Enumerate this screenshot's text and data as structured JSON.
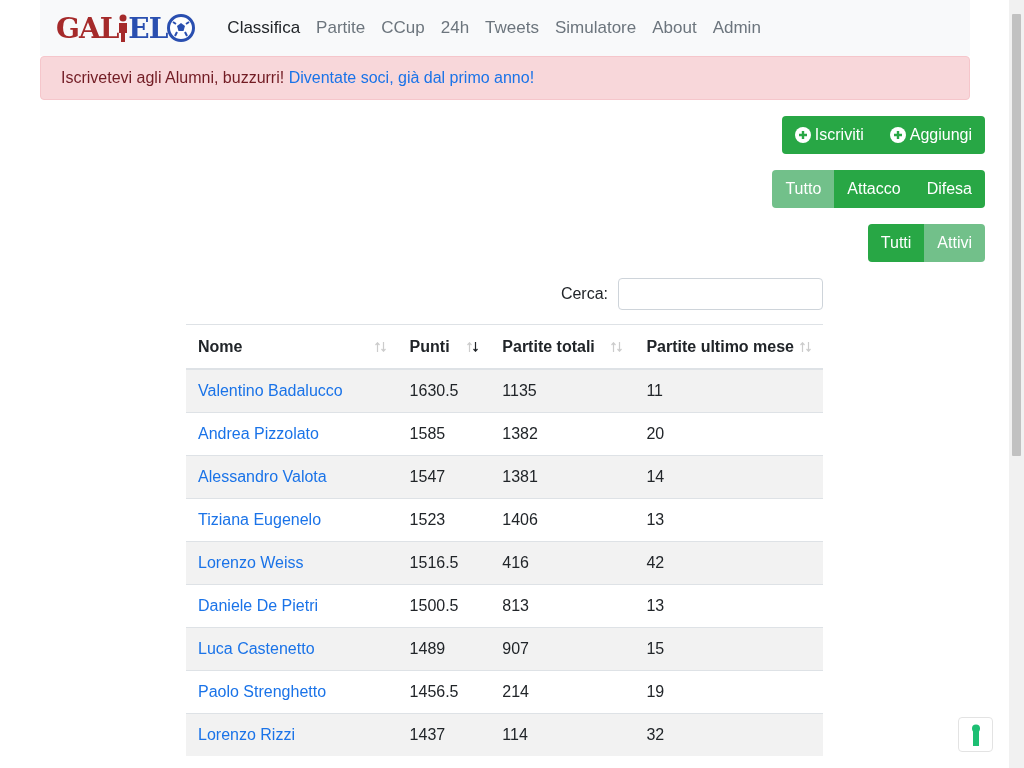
{
  "logo": {
    "left": "GAL",
    "right": "EL"
  },
  "nav": [
    {
      "label": "Classifica",
      "selected": true
    },
    {
      "label": "Partite",
      "selected": false
    },
    {
      "label": "CCup",
      "selected": false
    },
    {
      "label": "24h",
      "selected": false
    },
    {
      "label": "Tweets",
      "selected": false
    },
    {
      "label": "Simulatore",
      "selected": false
    },
    {
      "label": "About",
      "selected": false
    },
    {
      "label": "Admin",
      "selected": false
    }
  ],
  "alert": {
    "text": "Iscrivetevi agli Alumni, buzzurri! ",
    "link": "Diventate soci, già dal primo anno!"
  },
  "actions": [
    "Iscriviti",
    "Aggiungi"
  ],
  "role_filter": [
    {
      "label": "Tutto",
      "selected": true
    },
    {
      "label": "Attacco",
      "selected": false
    },
    {
      "label": "Difesa",
      "selected": false
    }
  ],
  "status_filter": [
    {
      "label": "Tutti",
      "selected": false
    },
    {
      "label": "Attivi",
      "selected": true
    }
  ],
  "search": {
    "label": "Cerca:"
  },
  "table": {
    "columns": [
      {
        "label": "Nome",
        "sorted": false
      },
      {
        "label": "Punti",
        "sorted": true
      },
      {
        "label": "Partite totali",
        "sorted": false
      },
      {
        "label": "Partite ultimo mese",
        "sorted": false
      }
    ],
    "rows": [
      [
        "Valentino Badalucco",
        "1630.5",
        "1135",
        "11"
      ],
      [
        "Andrea Pizzolato",
        "1585",
        "1382",
        "20"
      ],
      [
        "Alessandro Valota",
        "1547",
        "1381",
        "14"
      ],
      [
        "Tiziana Eugenelo",
        "1523",
        "1406",
        "13"
      ],
      [
        "Lorenzo Weiss",
        "1516.5",
        "416",
        "42"
      ],
      [
        "Daniele De Pietri",
        "1500.5",
        "813",
        "13"
      ],
      [
        "Luca Castenetto",
        "1489",
        "907",
        "15"
      ],
      [
        "Paolo Strenghetto",
        "1456.5",
        "214",
        "19"
      ],
      [
        "Lorenzo Rizzi",
        "1437",
        "114",
        "32"
      ]
    ]
  }
}
